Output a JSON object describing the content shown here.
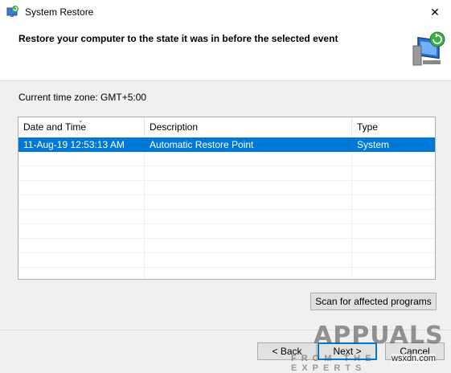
{
  "window": {
    "title": "System Restore",
    "close_glyph": "✕",
    "icon": "system-restore-icon"
  },
  "header": {
    "title": "Restore your computer to the state it was in before the selected event",
    "icon": "restore-monitor-icon"
  },
  "timezone_text": "Current time zone: GMT+5:00",
  "table": {
    "columns": [
      "Date and Time",
      "Description",
      "Type"
    ],
    "sorted_column": "Date and Time",
    "rows": [
      {
        "date": "11-Aug-19 12:53:13 AM",
        "description": "Automatic Restore Point",
        "type": "System",
        "selected": true
      }
    ]
  },
  "buttons": {
    "scan": "Scan for affected programs",
    "back": "< Back",
    "next": "Next >",
    "cancel": "Cancel"
  },
  "watermark": {
    "brand": "APPUALS",
    "tagline": "FROM THE EXPERTS",
    "site": "wsxdn.com"
  },
  "colors": {
    "selection": "#0078d7",
    "background": "#f0f0f0"
  }
}
